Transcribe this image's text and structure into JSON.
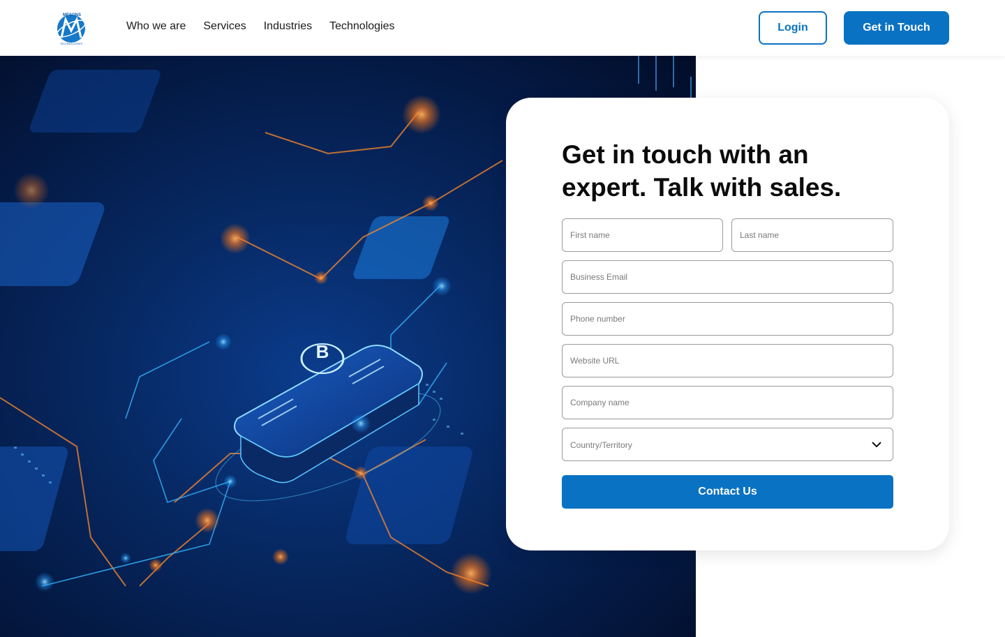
{
  "brand": {
    "logo_text": "MESONS",
    "logo_subtext": "TECHNOLOGIES",
    "accent": "#0a72c2"
  },
  "nav": {
    "items": [
      {
        "label": "Who we are"
      },
      {
        "label": "Services"
      },
      {
        "label": "Industries"
      },
      {
        "label": "Technologies"
      }
    ]
  },
  "header": {
    "login_label": "Login",
    "cta_label": "Get in Touch"
  },
  "hero": {
    "image_icon": "bitcoin-chip-circuit-illustration"
  },
  "form": {
    "title": "Get in touch with an expert. Talk with sales.",
    "first_name_placeholder": "First name",
    "last_name_placeholder": "Last name",
    "email_placeholder": "Business Email",
    "phone_placeholder": "Phone number",
    "website_placeholder": "Website URL",
    "company_placeholder": "Company name",
    "country_selected": "Country/Territory",
    "submit_label": "Contact Us"
  }
}
